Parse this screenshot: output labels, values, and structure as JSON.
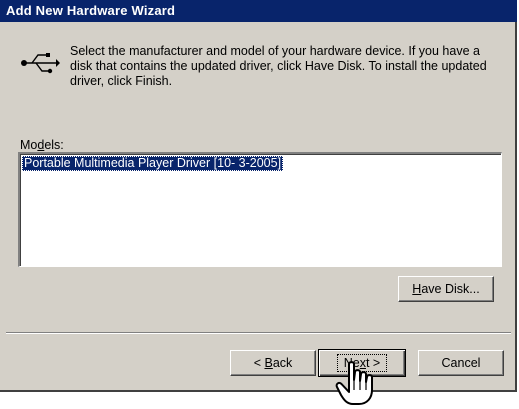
{
  "window": {
    "title": "Add New Hardware Wizard"
  },
  "header": {
    "icon": "usb-icon",
    "instructions": "Select the manufacturer and model of your hardware device. If you have a disk that contains the updated driver, click Have Disk. To install the updated driver, click Finish."
  },
  "models": {
    "label_mnemonic": "d",
    "label_prefix": "Mo",
    "label_suffix": "els:",
    "items": [
      "Portable Multimedia Player Driver [10- 3-2005]"
    ],
    "selected_index": 0
  },
  "buttons": {
    "have_disk_mnemonic": "H",
    "have_disk_rest": "ave Disk...",
    "back_prefix": "< ",
    "back_mnemonic": "B",
    "back_rest": "ack",
    "next_prefix": "Ne",
    "next_mnemonic": "x",
    "next_rest": "t >",
    "cancel": "Cancel"
  },
  "cursor": {
    "icon": "hand-pointer-icon"
  },
  "colors": {
    "title_bar": "#08246b",
    "dialog_face": "#d4d0c8",
    "selection": "#08246b"
  }
}
